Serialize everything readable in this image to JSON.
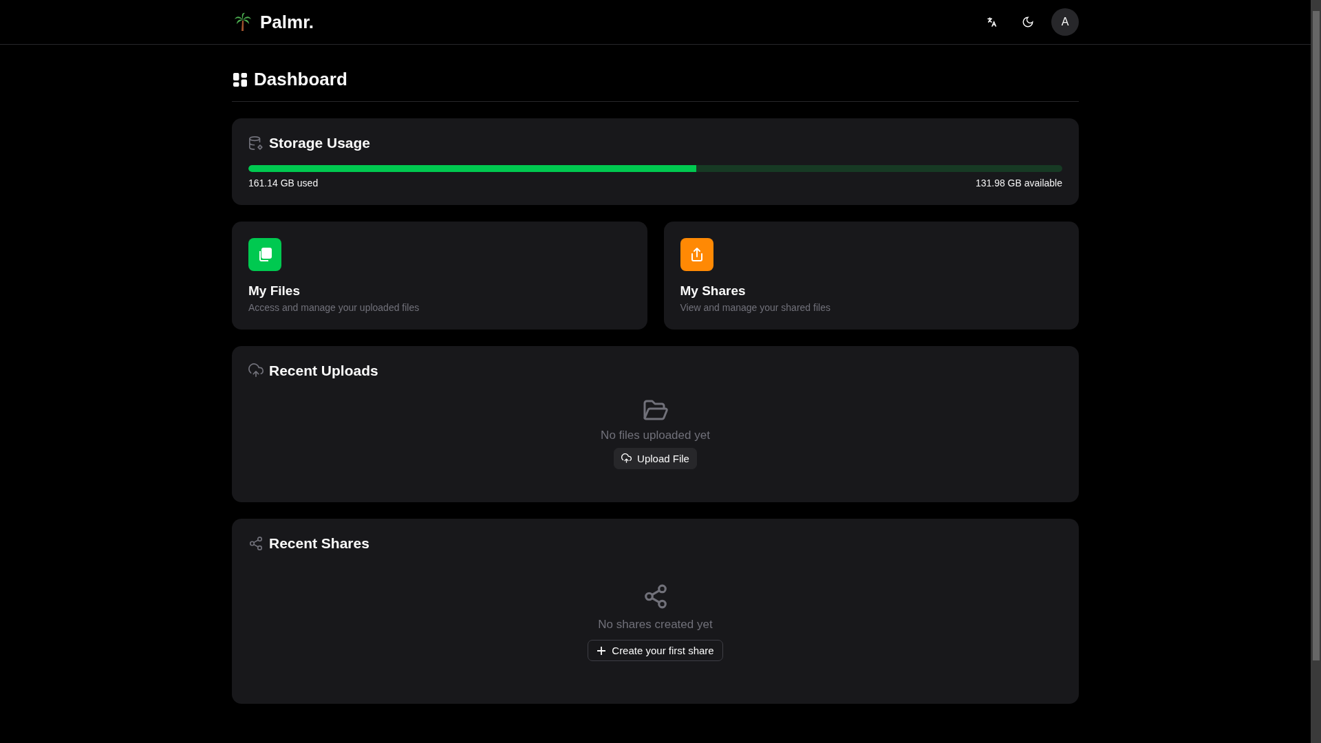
{
  "header": {
    "brand": "Palmr.",
    "avatar": "A"
  },
  "page_title": "Dashboard",
  "storage": {
    "title": "Storage Usage",
    "level": 0.55,
    "used": "161.14 GB used",
    "available": "131.98 GB available"
  },
  "quick_cards": [
    {
      "kind": "files",
      "title": "My Files",
      "description": "Access and manage your uploaded files",
      "color": "#00c950"
    },
    {
      "kind": "shares",
      "title": "My Shares",
      "description": "View and manage your shared files",
      "color": "#ff8904"
    }
  ],
  "recent_uploads": {
    "title": "Recent Uploads",
    "empty_text": "No files uploaded yet",
    "button": "Upload File"
  },
  "recent_shares": {
    "title": "Recent Shares",
    "empty_text": "No shares created yet",
    "button": "Create your first share"
  }
}
